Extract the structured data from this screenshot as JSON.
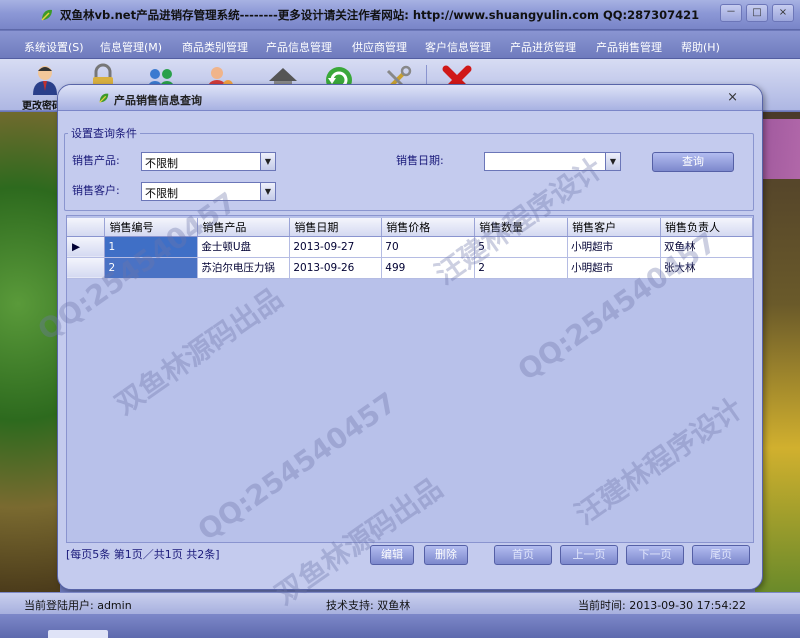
{
  "window": {
    "title": "双鱼林vb.net产品进销存管理系统--------更多设计请关注作者网站: http://www.shuangyulin.com QQ:287307421",
    "controls": [
      "－",
      "□",
      "×"
    ]
  },
  "menu": {
    "items": [
      "系统设置(S)",
      "信息管理(M)",
      "商品类别管理",
      "产品信息管理",
      "供应商管理",
      "客户信息管理",
      "产品进货管理",
      "产品销售管理",
      "帮助(H)"
    ]
  },
  "toolbar": {
    "first_label": "更改密码",
    "icons": [
      "user-icon",
      "lock-icon",
      "users-group-icon",
      "customer-icon",
      "house-icon",
      "refresh-icon",
      "tools-icon",
      "exit-icon"
    ]
  },
  "dialog": {
    "title": "产品销售信息查询",
    "close": "×",
    "filter_group": "设置查询条件",
    "product_label": "销售产品:",
    "product_value": "不限制",
    "customer_label": "销售客户:",
    "customer_value": "不限制",
    "date_label": "销售日期:",
    "date_value": "",
    "query_button": "查询"
  },
  "grid": {
    "columns": [
      "销售编号",
      "销售产品",
      "销售日期",
      "销售价格",
      "销售数量",
      "销售客户",
      "销售负责人"
    ],
    "rows": [
      {
        "marker": "▶",
        "cells": [
          "1",
          "金士顿U盘",
          "2013-09-27",
          "70",
          "5",
          "小明超市",
          "双鱼林"
        ]
      },
      {
        "marker": "",
        "cells": [
          "2",
          "苏泊尔电压力锅",
          "2013-09-26",
          "499",
          "2",
          "小明超市",
          "张大林"
        ]
      }
    ]
  },
  "pagination": {
    "info": "[每页5条  第1页／共1页    共2条]",
    "edit": "编辑",
    "delete": "删除",
    "first": "首页",
    "prev": "上一页",
    "next": "下一页",
    "last": "尾页"
  },
  "status": {
    "user": "当前登陆用户:   admin",
    "support": "技术支持:  双鱼林",
    "time": "当前时间:   2013-09-30 17:54:22"
  },
  "watermarks": [
    "QQ:254540457",
    "双鱼林源码出品",
    "汪建林程序设计"
  ]
}
